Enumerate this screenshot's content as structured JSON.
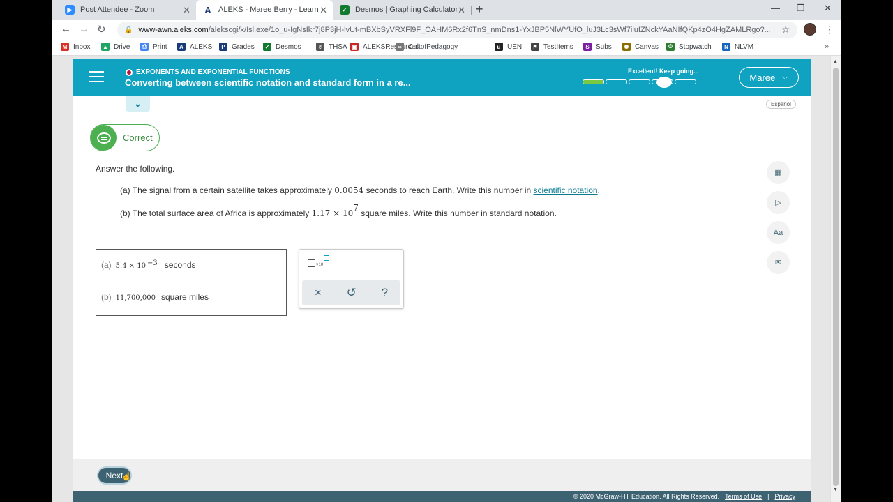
{
  "browser": {
    "tabs": [
      {
        "title": "Post Attendee - Zoom",
        "icon": "zoom-icon",
        "color": "#2d8cff"
      },
      {
        "title": "ALEKS - Maree Berry - Learn",
        "icon": "aleks-icon",
        "color": "#1a3b7a"
      },
      {
        "title": "Desmos | Graphing Calculator",
        "icon": "desmos-icon",
        "color": "#127a2e"
      }
    ],
    "new_tab": "+",
    "url_host": "www-awn.aleks.com",
    "url_path": "/alekscgi/x/Isl.exe/1o_u-IgNsIkr7j8P3jH-lvUt-mBXbSyVRXFl9F_OAHM6Rx2f6TnS_nmDns1-YxJBP5NlWYUfO_luJ3Lc3sWf7iluIZNckYAaNIfQKp4zO4HgZAMLRgo?...",
    "window_controls": {
      "minimize": "—",
      "maximize": "❐",
      "close": "✕"
    }
  },
  "bookmarks": [
    {
      "label": "Inbox",
      "icon": "gmail-icon",
      "color": "#d93025"
    },
    {
      "label": "Drive",
      "icon": "drive-icon",
      "color": "#1fa463"
    },
    {
      "label": "Print",
      "icon": "print-icon",
      "color": "#4285f4"
    },
    {
      "label": "ALEKS",
      "icon": "aleks-icon",
      "color": "#1a3b7a"
    },
    {
      "label": "Grades",
      "icon": "grades-icon",
      "color": "#1a3b7a"
    },
    {
      "label": "Desmos",
      "icon": "desmos-icon",
      "color": "#127a2e"
    },
    {
      "label": "THSA",
      "icon": "thsa-icon",
      "color": "#555555"
    },
    {
      "label": "ALEKSResources",
      "icon": "resources-icon",
      "color": "#c62828"
    },
    {
      "label": "CultofPedagogy",
      "icon": "link-icon",
      "color": "#777777"
    },
    {
      "label": "UEN",
      "icon": "uen-icon",
      "color": "#222222"
    },
    {
      "label": "TestItems",
      "icon": "flag-icon",
      "color": "#444444"
    },
    {
      "label": "Subs",
      "icon": "subs-icon",
      "color": "#7b1fa2"
    },
    {
      "label": "Canvas",
      "icon": "canvas-icon",
      "color": "#8a6d00"
    },
    {
      "label": "Stopwatch",
      "icon": "stopwatch-icon",
      "color": "#2e7d32"
    },
    {
      "label": "NLVM",
      "icon": "nlvm-icon",
      "color": "#1565c0"
    }
  ],
  "bookmarks_more": "»",
  "aleks": {
    "topic_category": "EXPONENTS AND EXPONENTIAL FUNCTIONS",
    "topic_title": "Converting between scientific notation and standard form in a re...",
    "progress_text": "Excellent! Keep going...",
    "progress_fraction": 0.2,
    "user_name": "Maree",
    "espanol": "Español",
    "status": "Correct",
    "prompt": "Answer the following.",
    "question_a": {
      "prefix": "(a) The signal from a certain satellite takes approximately",
      "value": "0.0054",
      "middle": "seconds to reach Earth. Write this number in",
      "link": "scientific notation",
      "suffix": "."
    },
    "question_b": {
      "prefix": "(b) The total surface area of Africa is approximately",
      "base": "1.17 × 10",
      "exponent": "7",
      "suffix": "square miles. Write this number in standard notation."
    },
    "answer_a": {
      "label": "(a)",
      "base": "5.4  ×  10",
      "exponent": "−3",
      "unit": "seconds"
    },
    "answer_b": {
      "label": "(b)",
      "value": "11,700,000",
      "unit": "square miles"
    },
    "keypad": {
      "sci_label": "×10",
      "clear": "×",
      "undo": "↺",
      "help": "?"
    },
    "next_label": "Next",
    "copyright": "© 2020 McGraw-Hill Education. All Rights Reserved.",
    "terms": "Terms of Use",
    "separator": "|",
    "privacy": "Privacy"
  },
  "colors": {
    "aleks_header": "#0fa3c1",
    "correct_green": "#4caf50",
    "footer": "#3d6272"
  }
}
